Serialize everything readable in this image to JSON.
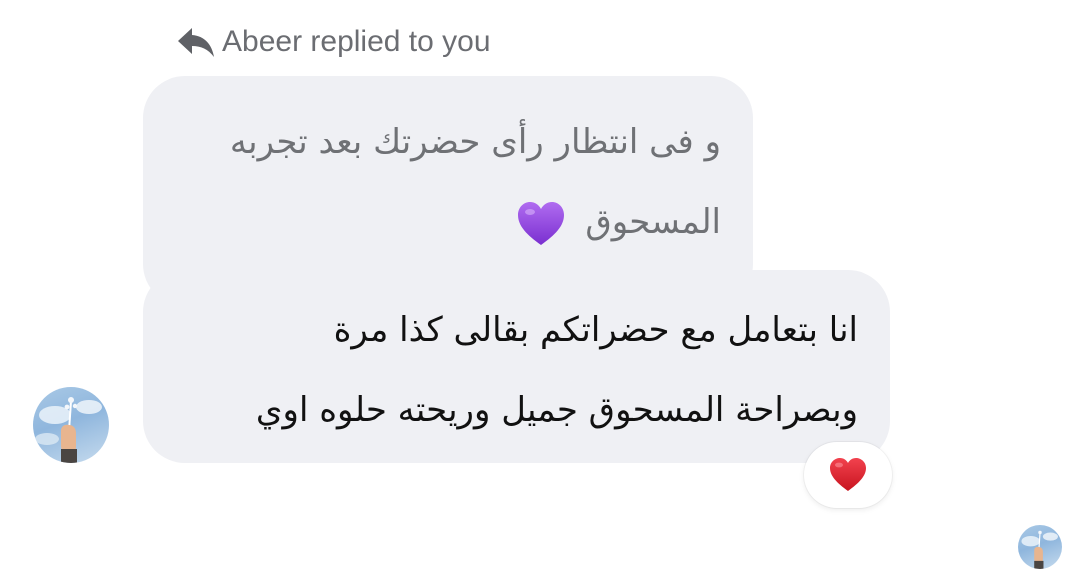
{
  "reply_header": {
    "icon": "reply-arrow-icon",
    "text": "Abeer replied to you"
  },
  "quoted_message": {
    "line1": "و فى انتظار رأى حضرتك بعد تجربه",
    "line2": "المسحوق",
    "emoji": "purple-heart"
  },
  "reply_message": {
    "line1": "انا بتعامل مع حضراتكم بقالى كذا مرة",
    "line2": "وبصراحة المسحوق جميل وريحته حلوه اوي"
  },
  "reaction": {
    "emoji": "red-heart"
  },
  "colors": {
    "bubble_bg": "#eff0f4",
    "quoted_text": "#6f7175",
    "message_text": "#111111",
    "header_text": "#6b6d72",
    "purple_heart": "#9b4de3",
    "red_heart": "#e0202f"
  }
}
